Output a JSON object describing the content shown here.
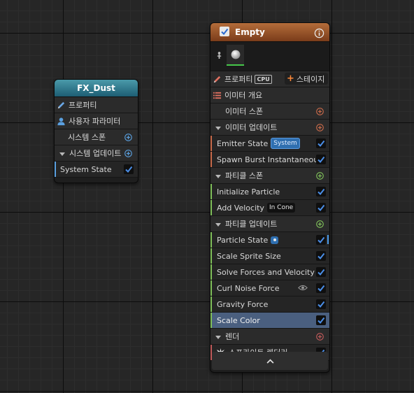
{
  "system_node": {
    "title": "FX_Dust",
    "rows": {
      "properties": "프로퍼티",
      "user_params": "사용자 파라미터",
      "system_spawn": "시스템 스폰",
      "system_update": "시스템 업데이트",
      "system_state": "System State"
    }
  },
  "emitter_node": {
    "title": "Empty",
    "properties": "프로퍼티",
    "cpu_badge": "CPU",
    "stage_button": "스테이지",
    "emitter_summary": "이미터 개요",
    "emitter_spawn": "이미터 스폰",
    "emitter_update": "이미터 업데이트",
    "emitter_update_items": [
      {
        "label": "Emitter State",
        "tag": "System"
      },
      {
        "label": "Spawn Burst Instantaneous"
      }
    ],
    "particle_spawn": "파티클 스폰",
    "particle_spawn_items": [
      {
        "label": "Initialize Particle"
      },
      {
        "label": "Add Velocity",
        "tag": "In Cone"
      }
    ],
    "particle_update": "파티클 업데이트",
    "particle_update_items": [
      {
        "label": "Particle State"
      },
      {
        "label": "Scale Sprite Size"
      },
      {
        "label": "Solve Forces and Velocity"
      },
      {
        "label": "Curl Noise Force"
      },
      {
        "label": "Gravity Force"
      },
      {
        "label": "Scale Color"
      }
    ],
    "render": "렌더",
    "render_items": [
      {
        "label": "스프라이트 렌더러"
      }
    ]
  },
  "colors": {
    "checkmark": "#4a8ee8",
    "emitter_accent": "#c86a4a",
    "spawn_accent": "#7fbf5a",
    "system_accent": "#5aa0e0",
    "render_accent": "#c05a5a",
    "selected_row": "#4a5f7f"
  }
}
